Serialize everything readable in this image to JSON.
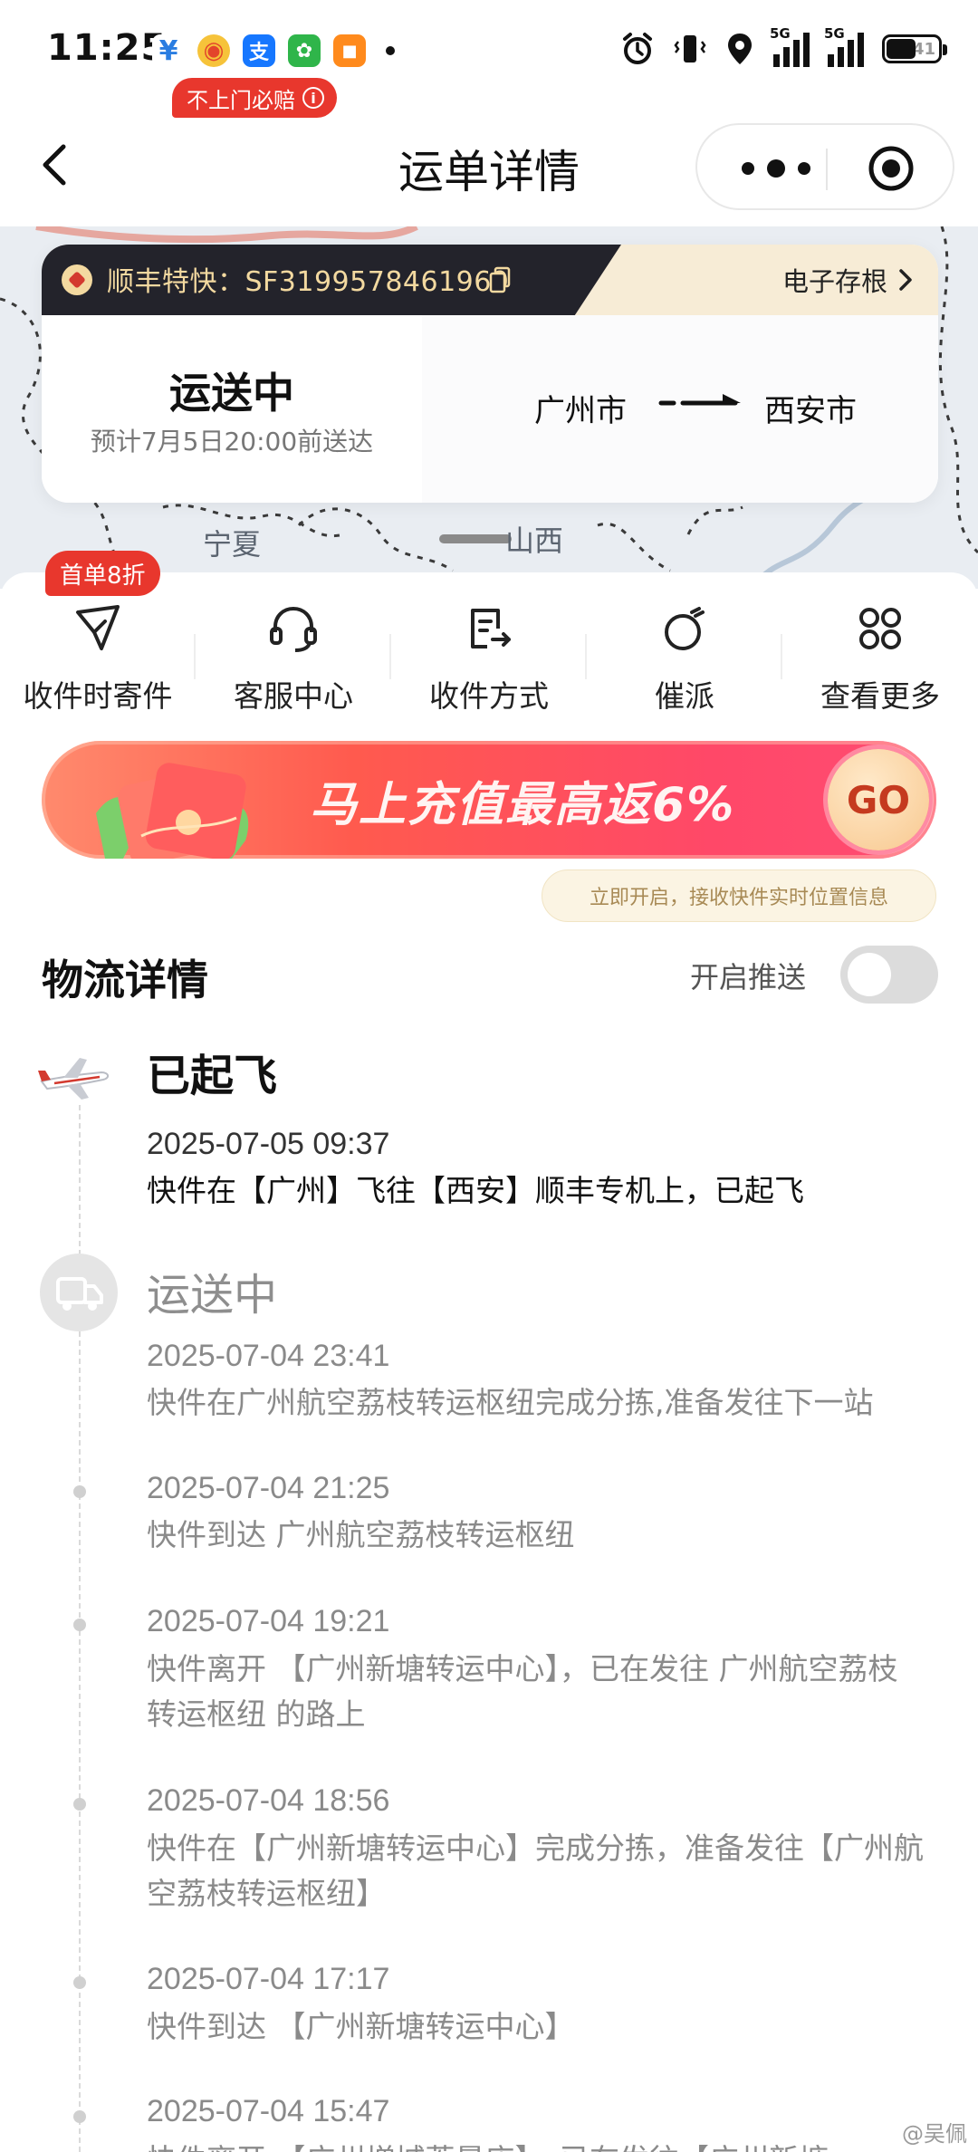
{
  "status_bar": {
    "time": "11:25",
    "apps": [
      {
        "icon": "currency-icon",
        "color": "#2a7de1",
        "glyph": "¥"
      },
      {
        "icon": "weibo-icon",
        "color": "#e3452b",
        "glyph": "◉"
      },
      {
        "icon": "alipay-icon",
        "color": "#1677ff",
        "glyph": "支"
      },
      {
        "icon": "wechat-mini-icon",
        "color": "#2fb54a",
        "glyph": "✿"
      },
      {
        "icon": "reader-icon",
        "color": "#ff8a1c",
        "glyph": "■"
      }
    ],
    "signal_1_tag": "5G",
    "signal_2_tag": "5G",
    "battery": "41"
  },
  "nav": {
    "title": "运单详情"
  },
  "map": {
    "labels": [
      "宁夏",
      "山西"
    ]
  },
  "waybill": {
    "number_text": "顺丰特快：SF3199578461969",
    "receipt_label": "电子存根",
    "guarantee_tag": "不上门必赔",
    "status": "运送中",
    "eta": "预计7月5日20:00前送达",
    "from_city": "广州市",
    "to_city": "西安市"
  },
  "actions": {
    "first_order_tag": "首单8折",
    "items": [
      {
        "label": "收件时寄件",
        "icon": "paper-plane-icon"
      },
      {
        "label": "客服中心",
        "icon": "headset-icon"
      },
      {
        "label": "收件方式",
        "icon": "receive-method-icon"
      },
      {
        "label": "催派",
        "icon": "stopwatch-icon"
      },
      {
        "label": "查看更多",
        "icon": "grid-more-icon"
      }
    ]
  },
  "banner": {
    "text": "马上充值最高返6%",
    "go_label": "GO"
  },
  "tip": {
    "text": "立即开启，接收快件实时位置信息"
  },
  "logistics": {
    "title": "物流详情",
    "push_label": "开启推送",
    "push_enabled": false,
    "stages": [
      {
        "title": "已起飞",
        "icon": "airplane-icon",
        "events": [
          {
            "time": "2025-07-05 09:37",
            "desc": "快件在【广州】飞往【西安】顺丰专机上，已起飞"
          }
        ]
      },
      {
        "title": "运送中",
        "icon": "truck-icon",
        "events": [
          {
            "time": "2025-07-04 23:41",
            "desc": "快件在广州航空荔枝转运枢纽完成分拣,准备发往下一站"
          },
          {
            "time": "2025-07-04 21:25",
            "desc": "快件到达 广州航空荔枝转运枢纽"
          },
          {
            "time": "2025-07-04 19:21",
            "desc": "快件离开 【广州新塘转运中心】，已在发往 广州航空荔枝转运枢纽 的路上"
          },
          {
            "time": "2025-07-04 18:56",
            "desc": "快件在【广州新塘转运中心】完成分拣，准备发往【广州航空荔枝转运枢纽】"
          },
          {
            "time": "2025-07-04 17:17",
            "desc": "快件到达 【广州新塘转运中心】"
          },
          {
            "time": "2025-07-04 15:47",
            "desc": "快件离开 【广州増城荔景店】，已在发往【广州新塘"
          }
        ]
      }
    ]
  },
  "watermark": "@吴佩",
  "colors": {
    "brand_red": "#e8372d",
    "header_dark": "#23232b",
    "header_gold": "#f3d9a0"
  }
}
